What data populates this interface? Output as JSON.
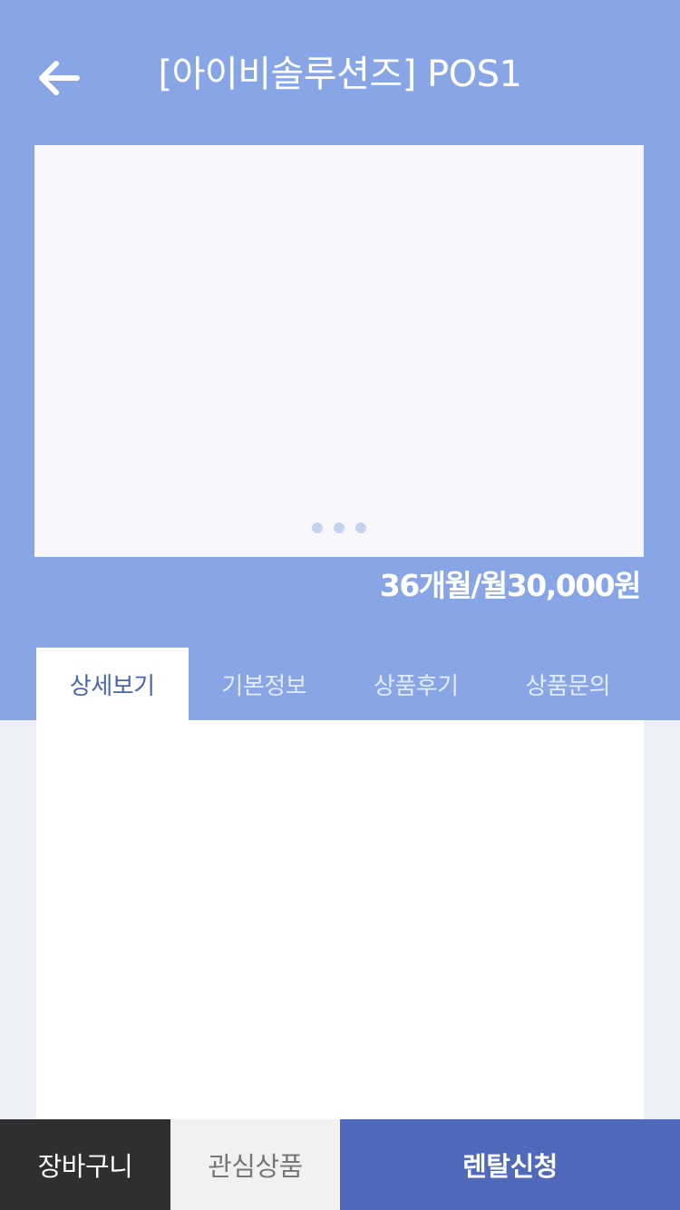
{
  "header": {
    "title": "[아이비솔루션즈] POS1",
    "back_icon": "arrow-left-icon"
  },
  "carousel": {
    "slide_count": 3
  },
  "product": {
    "price": "36개월/월30,000원"
  },
  "tabs": [
    {
      "label": "상세보기",
      "active": true
    },
    {
      "label": "기본정보",
      "active": false
    },
    {
      "label": "상품후기",
      "active": false
    },
    {
      "label": "상품문의",
      "active": false
    }
  ],
  "bottom_bar": {
    "cart_label": "장바구니",
    "wishlist_label": "관심상품",
    "rent_label": "렌탈신청"
  },
  "colors": {
    "header_bg": "#88a6e6",
    "accent": "#5169bb",
    "active_tab_text": "#4a64b5",
    "cart_bg": "#2f2f2f"
  }
}
